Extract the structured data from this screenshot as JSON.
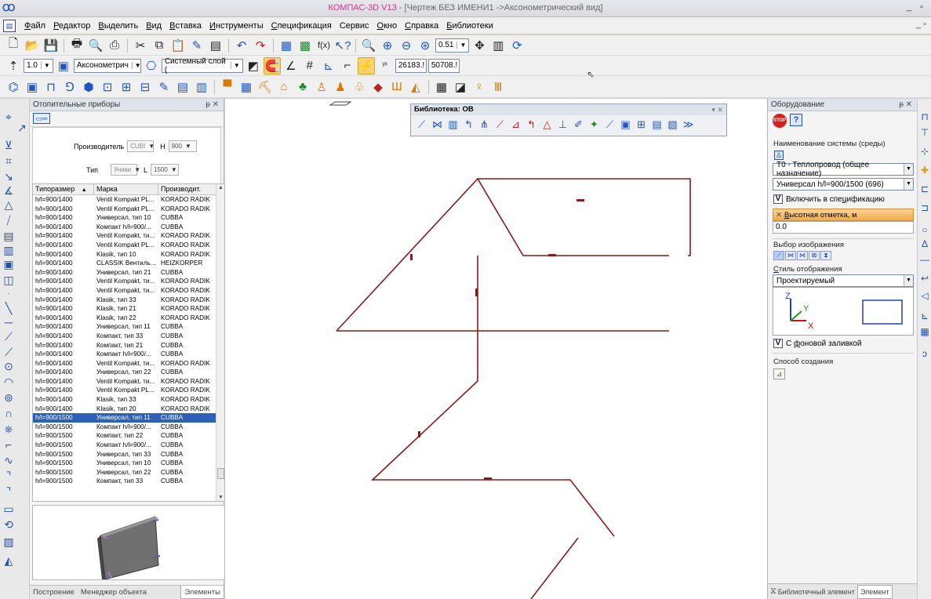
{
  "window": {
    "app_name": "КОМПАС-3D V13",
    "doc_title": " - [Чертеж БЕЗ ИМЕНИ1 ->Аксонометрический вид]",
    "minimize": "_",
    "restore": "▫"
  },
  "menu": {
    "items": [
      {
        "key": "Ф",
        "label": "айл"
      },
      {
        "key": "Р",
        "label": "едактор"
      },
      {
        "key": "В",
        "label": "ыделить"
      },
      {
        "key": "В",
        "label": "ид"
      },
      {
        "key": "В",
        "label": "ставка"
      },
      {
        "key": "И",
        "label": "нструменты"
      },
      {
        "key": "С",
        "label": "пецификация"
      },
      {
        "key": "",
        "label": "Сервис"
      },
      {
        "key": "О",
        "label": "кно"
      },
      {
        "key": "С",
        "label": "правка"
      },
      {
        "key": "Б",
        "label": "иблиотеки"
      }
    ],
    "doc_controls": "_ ▫"
  },
  "toolbar1": {
    "zoom_value": "0.51"
  },
  "toolbar2": {
    "step_value": "1.0",
    "view_combo": "Аксонометрич",
    "layer_combo": "Системный слой (",
    "coord_x": "26183.!",
    "coord_y": "50708.!"
  },
  "left_panel": {
    "title": "Отопительные приборы",
    "pin": "ᵽ ✕",
    "filter": {
      "manufacturer_label": "Производитель",
      "manufacturer_value": "CUBI",
      "h_label": "H",
      "h_value": "900",
      "type_label": "Тип",
      "type_value": "Униве",
      "l_label": "L",
      "l_value": "1500"
    },
    "columns": [
      "Типоразмер",
      "Марка",
      "Производит."
    ],
    "rows": [
      [
        "h/l=900/1400",
        "Ventil Kompakt PL...",
        "KORADO RADIK"
      ],
      [
        "h/l=900/1400",
        "Ventil Kompakt PL...",
        "KORADO RADIK"
      ],
      [
        "h/l=900/1400",
        "Универсал, тип 10",
        "CUBBA"
      ],
      [
        "h/l=900/1400",
        "Компакт h/l=900/...",
        "CUBBA"
      ],
      [
        "h/l=900/1400",
        "Ventil Kompakt, ти...",
        "KORADO RADIK"
      ],
      [
        "h/l=900/1400",
        "Ventil Kompakt PL...",
        "KORADO RADIK"
      ],
      [
        "h/l=900/1400",
        "Klasik, тип 10",
        "KORADO RADIK"
      ],
      [
        "h/l=900/1400",
        "CLASSIK Вентиль...",
        "HEIZKORPER"
      ],
      [
        "h/l=900/1400",
        "Универсал, тип 21",
        "CUBBA"
      ],
      [
        "h/l=900/1400",
        "Ventil Kompakt, ти...",
        "KORADO RADIK"
      ],
      [
        "h/l=900/1400",
        "Ventil Kompakt, ти...",
        "KORADO RADIK"
      ],
      [
        "h/l=900/1400",
        "Klasik, тип 33",
        "KORADO RADIK"
      ],
      [
        "h/l=900/1400",
        "Klasik, тип 21",
        "KORADO RADIK"
      ],
      [
        "h/l=900/1400",
        "Klasik, тип 22",
        "KORADO RADIK"
      ],
      [
        "h/l=900/1400",
        "Универсал, тип 11",
        "CUBBA"
      ],
      [
        "h/l=900/1400",
        "Компакт, тип 33",
        "CUBBA"
      ],
      [
        "h/l=900/1400",
        "Компакт, тип 21",
        "CUBBA"
      ],
      [
        "h/l=900/1400",
        "Компакт h/l=900/...",
        "CUBBA"
      ],
      [
        "h/l=900/1400",
        "Ventil Kompakt, ти...",
        "KORADO RADIK"
      ],
      [
        "h/l=900/1400",
        "Универсал, тип 22",
        "CUBBA"
      ],
      [
        "h/l=900/1400",
        "Ventil Kompakt, ти...",
        "KORADO RADIK"
      ],
      [
        "h/l=900/1400",
        "Ventil Kompakt PL...",
        "KORADO RADIK"
      ],
      [
        "h/l=900/1400",
        "Klasik, тип 33",
        "KORADO RADIK"
      ],
      [
        "h/l=900/1400",
        "Klasik, тип 20",
        "KORADO RADIK"
      ],
      [
        "h/l=900/1500",
        "Универсал, тип 11",
        "CUBBA"
      ],
      [
        "h/l=900/1500",
        "Компакт h/l=900/...",
        "CUBBA"
      ],
      [
        "h/l=900/1500",
        "Компакт, тип 22",
        "CUBBA"
      ],
      [
        "h/l=900/1500",
        "Компакт h/l=900/...",
        "CUBBA"
      ],
      [
        "h/l=900/1500",
        "Универсал, тип 33",
        "CUBBA"
      ],
      [
        "h/l=900/1500",
        "Универсал, тип 10",
        "CUBBA"
      ],
      [
        "h/l=900/1500",
        "Универсал, тип 22",
        "CUBBA"
      ],
      [
        "h/l=900/1500",
        "Компакт, тип 33",
        "CUBBA"
      ]
    ],
    "selected_row": 24,
    "tabs": [
      "Построение",
      "Менеджер объекта строите...",
      "Элементы"
    ],
    "active_tab": 2
  },
  "library": {
    "title": "Библиотека: ОВ",
    "controls": "▾ ✕"
  },
  "right_panel": {
    "title": "Оборудование",
    "pin": "ᵽ ✕",
    "stop_label": "STOP",
    "help_label": "?",
    "system_label": "Наименование системы (среды)",
    "system_value": "Т0 - Теплопровод (общее назначение)",
    "model_value": "Универсал h/l=900/1500 (696)",
    "include_key": "ц",
    "include_pre": "Включить в спе",
    "include_post": "ификацию",
    "include_checked": "V",
    "height_key": "В",
    "height_label": "ысотная отметка, м",
    "height_value": "0.0",
    "image_select_label": "Выбор изображения",
    "display_style_key": "С",
    "display_style_label": "тиль отображения",
    "display_style_value": "Проектируемый",
    "axis_z": "Z",
    "axis_y": "Y",
    "axis_x": "X",
    "fill_checked": "V",
    "fill_pre": "С ",
    "fill_key": "ф",
    "fill_post": "оновой заливкой",
    "create_label": "Способ создания",
    "tabs": [
      "Библиотечный элемент",
      "Элемент"
    ],
    "active_tab": 1
  },
  "colors": {
    "pipe": "#8b1a1a",
    "selection": "#2d61b5",
    "active_field": "#f4a947"
  }
}
